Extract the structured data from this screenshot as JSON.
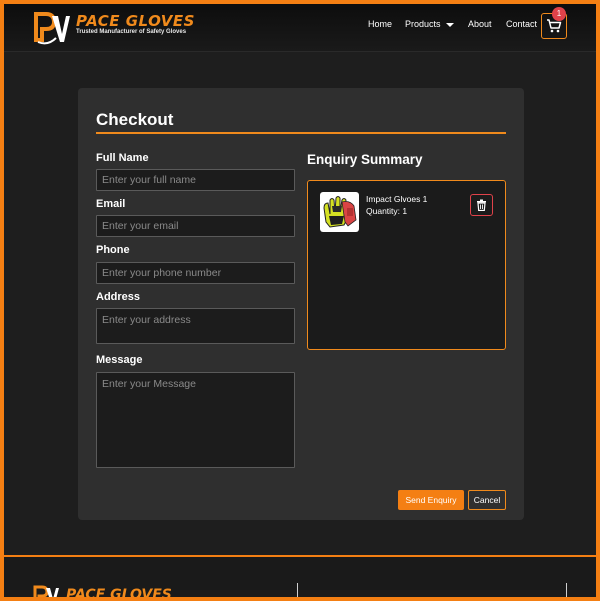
{
  "brand": {
    "name": "PACE GLOVES",
    "tagline": "Trusted Manufacturer of Safety Gloves",
    "accent_color": "#f47f13"
  },
  "nav": {
    "home": "Home",
    "products": "Products",
    "about": "About",
    "contact": "Contact",
    "cart_count": "1"
  },
  "checkout": {
    "title": "Checkout",
    "fields": {
      "full_name": {
        "label": "Full Name",
        "placeholder": "Enter your full name"
      },
      "email": {
        "label": "Email",
        "placeholder": "Enter your email"
      },
      "phone": {
        "label": "Phone",
        "placeholder": "Enter your phone number"
      },
      "address": {
        "label": "Address",
        "placeholder": "Enter your address"
      },
      "message": {
        "label": "Message",
        "placeholder": "Enter your Message"
      }
    },
    "summary": {
      "title": "Enquiry Summary",
      "items": [
        {
          "name": "Impact Glvoes 1",
          "quantity": "Quantity: 1",
          "icon": "glove-product-image"
        }
      ]
    },
    "buttons": {
      "send": "Send Enquiry",
      "cancel": "Cancel"
    }
  },
  "footer": {
    "brand": "PACE GLOVES"
  }
}
